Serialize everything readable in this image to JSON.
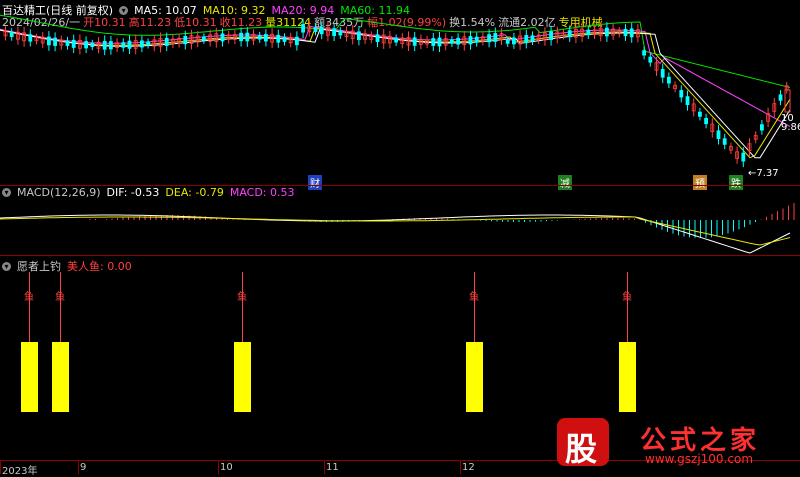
{
  "header": {
    "title": "百达精工(日线 前复权)",
    "ma": [
      {
        "label": "MA5: 10.07",
        "color": "#ffffff"
      },
      {
        "label": "MA10: 9.32",
        "color": "#e6e600"
      },
      {
        "label": "MA20: 9.94",
        "color": "#ff40ff"
      },
      {
        "label": "MA60: 11.94",
        "color": "#00e600"
      }
    ],
    "quote": {
      "date": "2024/02/26/一",
      "open": "开10.31",
      "high": "高11.23",
      "low": "低10.31",
      "close": "收11.23",
      "volume": "量31124",
      "amount": "额3435万",
      "change": "幅1.02(9.99%)",
      "turnover": "换1.54%",
      "float": "流通2.02亿",
      "sector": "专用机械"
    }
  },
  "price_panel": {
    "price_labels": [
      "10",
      "9.86"
    ],
    "low_annotation": "←7.37",
    "markers": [
      {
        "text": "财",
        "bg": "#2040c0"
      },
      {
        "text": "减",
        "bg": "#208020"
      },
      {
        "text": "预",
        "bg": "#c08020"
      },
      {
        "text": "跌",
        "bg": "#208020"
      }
    ]
  },
  "macd": {
    "title": "MACD(12,26,9)",
    "dif": "DIF: -0.53",
    "dea": "DEA: -0.79",
    "macd": "MACD: 0.53",
    "colors": {
      "dif": "#ffffff",
      "dea": "#e6e600",
      "macd": "#ff40ff"
    }
  },
  "indicator": {
    "title": "愿者上钓",
    "value_label": "美人鱼: 0.00",
    "signal_char": "鱼",
    "bar_color": "#ffff00",
    "signals": [
      {
        "pos": 0.036
      },
      {
        "pos": 0.075
      },
      {
        "pos": 0.302
      },
      {
        "pos": 0.592
      },
      {
        "pos": 0.784
      }
    ]
  },
  "x_axis": {
    "labels": [
      {
        "text": "2023年",
        "pos": 0.0
      },
      {
        "text": "9",
        "pos": 0.098
      },
      {
        "text": "10",
        "pos": 0.272
      },
      {
        "text": "11",
        "pos": 0.405
      },
      {
        "text": "12",
        "pos": 0.575
      }
    ]
  },
  "watermark": {
    "logo": "股",
    "text": "公式之家",
    "url": "www.gszj100.com"
  }
}
